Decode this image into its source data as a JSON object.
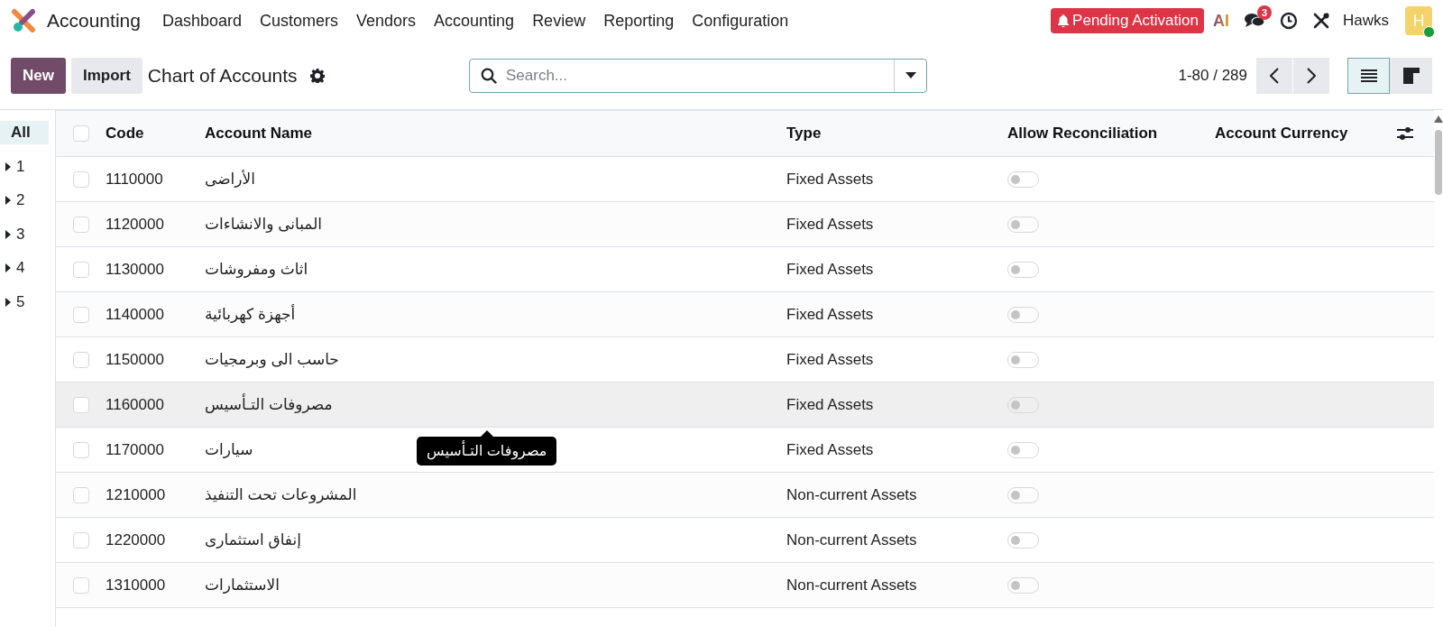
{
  "app": {
    "name": "Accounting"
  },
  "menu": [
    "Dashboard",
    "Customers",
    "Vendors",
    "Accounting",
    "Review",
    "Reporting",
    "Configuration"
  ],
  "systray": {
    "status_badge": "Pending Activation",
    "ai_label": "AI",
    "messages_count": "3",
    "user": "Hawks",
    "avatar_initial": "H",
    "online": true
  },
  "control_panel": {
    "new_button": "New",
    "import_button": "Import",
    "title": "Chart of Accounts",
    "search": {
      "placeholder": "Search..."
    },
    "pager": "1-80 / 289",
    "views": [
      {
        "kind": "list",
        "selected": true
      },
      {
        "kind": "kanban",
        "selected": false
      }
    ]
  },
  "sidebar": [
    {
      "label": "All",
      "selected": true,
      "expandable": false
    },
    {
      "label": "1",
      "selected": false,
      "expandable": true
    },
    {
      "label": "2",
      "selected": false,
      "expandable": true
    },
    {
      "label": "3",
      "selected": false,
      "expandable": true
    },
    {
      "label": "4",
      "selected": false,
      "expandable": true
    },
    {
      "label": "5",
      "selected": false,
      "expandable": true
    }
  ],
  "table": {
    "all_checked": false,
    "columns": [
      "Code",
      "Account Name",
      "Type",
      "Allow Reconciliation",
      "Account Currency"
    ],
    "rows": [
      {
        "code": "1110000",
        "name": "الأراضى",
        "type": "Fixed Assets",
        "reconcile": false,
        "hovered": false
      },
      {
        "code": "1120000",
        "name": "المبانى والانشاءات",
        "type": "Fixed Assets",
        "reconcile": false,
        "hovered": false
      },
      {
        "code": "1130000",
        "name": "اثاث ومفروشات",
        "type": "Fixed Assets",
        "reconcile": false,
        "hovered": false
      },
      {
        "code": "1140000",
        "name": "أجهزة كهربائية",
        "type": "Fixed Assets",
        "reconcile": false,
        "hovered": false
      },
      {
        "code": "1150000",
        "name": "حاسب الى وبرمجيات",
        "type": "Fixed Assets",
        "reconcile": false,
        "hovered": false
      },
      {
        "code": "1160000",
        "name": "مصروفات التـأسيس",
        "type": "Fixed Assets",
        "reconcile": false,
        "hovered": true,
        "tooltip": "مصروفات التـأسيس"
      },
      {
        "code": "1170000",
        "name": "سيارات",
        "type": "Fixed Assets",
        "reconcile": false,
        "hovered": false
      },
      {
        "code": "1210000",
        "name": "المشروعات تحت التنفيذ",
        "type": "Non-current Assets",
        "reconcile": false,
        "hovered": false
      },
      {
        "code": "1220000",
        "name": "إنفاق استثمارى",
        "type": "Non-current Assets",
        "reconcile": false,
        "hovered": false
      },
      {
        "code": "1310000",
        "name": "الاستثمارات",
        "type": "Non-current Assets",
        "reconcile": false,
        "hovered": false
      }
    ]
  }
}
